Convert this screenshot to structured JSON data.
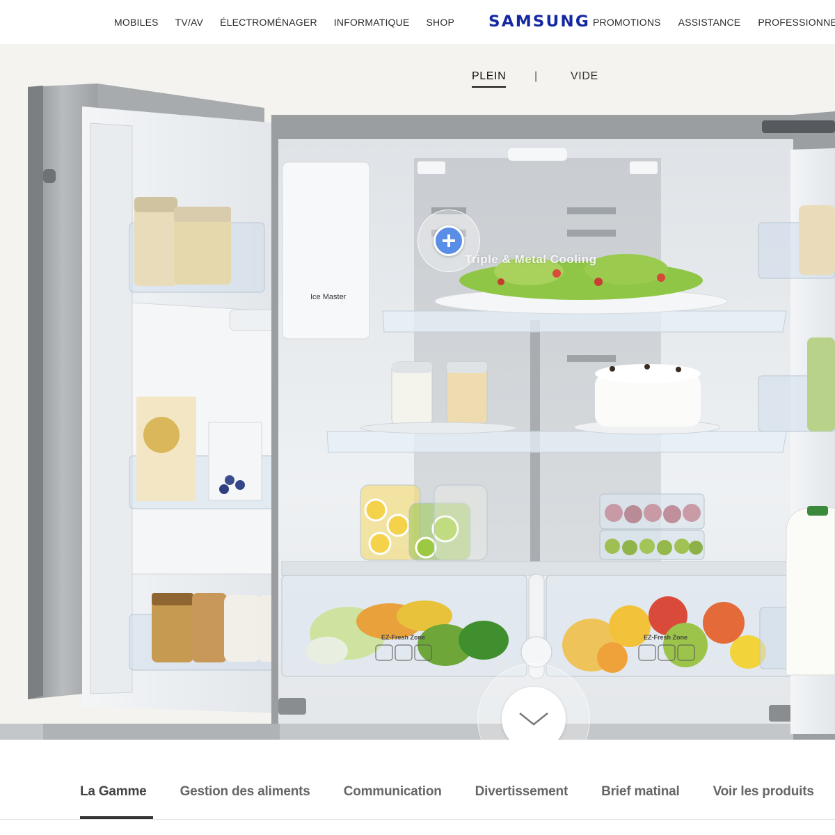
{
  "header": {
    "nav_left": [
      "MOBILES",
      "TV/AV",
      "ÉLECTROMÉNAGER",
      "INFORMATIQUE",
      "SHOP"
    ],
    "logo": "SAMSUNG",
    "nav_right": [
      "PROMOTIONS",
      "ASSISTANCE",
      "PROFESSIONNELS"
    ],
    "brand_color": "#1428a0"
  },
  "hero": {
    "toggle": {
      "full": "PLEIN",
      "separator": "|",
      "empty": "VIDE",
      "selected": "PLEIN"
    },
    "hotspot_icon": "plus-icon",
    "hotspot_color": "#5a8ee6",
    "feature_label": "Triple & Metal Cooling",
    "ice_maker_label": "Ice Master",
    "crisper_label_left": "EZ-Fresh Zone",
    "crisper_label_right": "EZ-Fresh Zone",
    "scroll_icon": "chevron-down-icon"
  },
  "tabs": {
    "items": [
      "La Gamme",
      "Gestion des aliments",
      "Communication",
      "Divertissement",
      "Brief matinal",
      "Voir les produits"
    ],
    "active": "La Gamme"
  }
}
